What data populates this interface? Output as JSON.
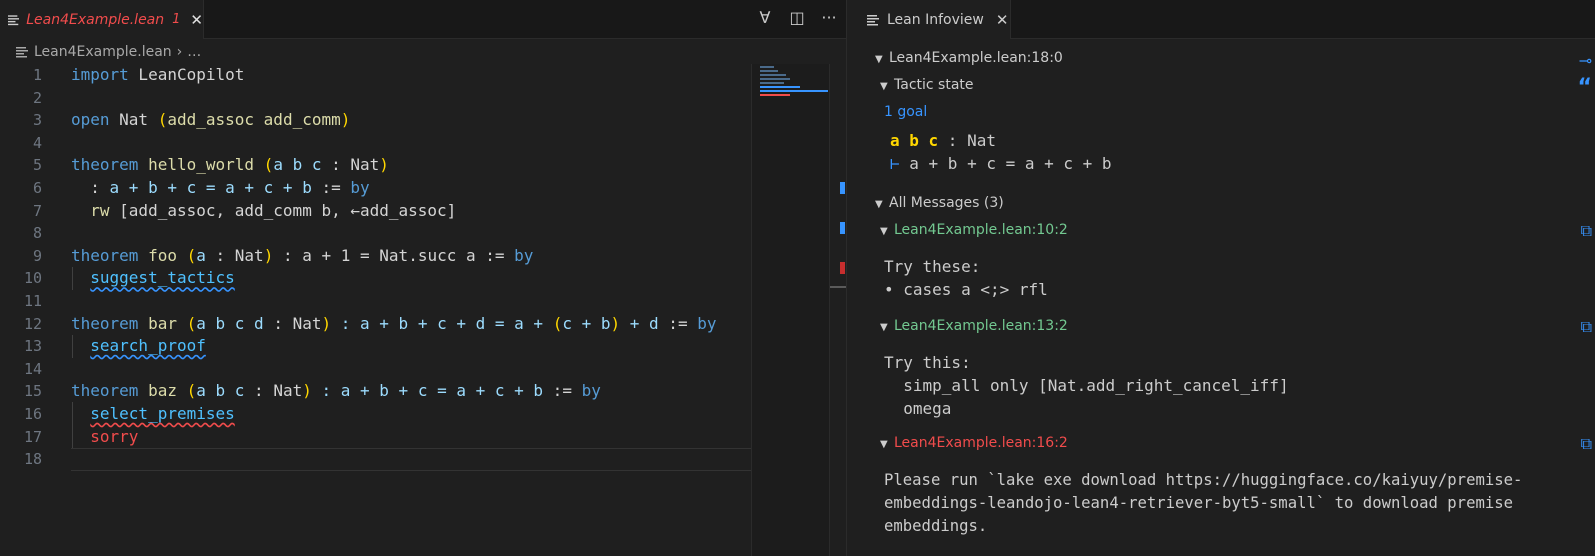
{
  "editor": {
    "tab": {
      "title": "Lean4Example.lean",
      "problem_count": "1"
    },
    "breadcrumb": {
      "file": "Lean4Example.lean",
      "more": "…"
    },
    "line_numbers": [
      "1",
      "2",
      "3",
      "4",
      "5",
      "6",
      "7",
      "8",
      "9",
      "10",
      "11",
      "12",
      "13",
      "14",
      "15",
      "16",
      "17",
      "18"
    ],
    "toolbar": {
      "lean_icon": "∀",
      "split": "◫",
      "more": "···"
    }
  },
  "code": {
    "l1": {
      "kw": "import",
      "rest": " LeanCopilot"
    },
    "l3": {
      "kw": "open",
      "rest": " Nat ",
      "lp": "(",
      "args": "add_assoc add_comm",
      "rp": ")"
    },
    "l5": {
      "kw": "theorem",
      "name": " hello_world ",
      "lp": "(",
      "vars": "a b c",
      "colon": " : Nat",
      "rp": ")"
    },
    "l6": {
      "pre": "  : ",
      "expr": "a + b + c = a + c + b",
      "assign": " := ",
      "by": "by"
    },
    "l7": {
      "pre": "  ",
      "tac": "rw",
      "rest": " [add_assoc, add_comm b, ←add_assoc]"
    },
    "l9": {
      "kw": "theorem",
      "name": " foo ",
      "lp": "(",
      "vars": "a",
      "colon": " : Nat",
      "rp": ")",
      "stmt": " : a + 1 = Nat.succ a",
      "assign": " := ",
      "by": "by"
    },
    "l10": {
      "pre": "  ",
      "tac": "suggest_tactics"
    },
    "l12": {
      "kw": "theorem",
      "name": " bar ",
      "lp": "(",
      "vars": "a b c d",
      "colon": " : Nat",
      "rp": ")",
      "s1": " : a + b + c + d = a + ",
      "lp2": "(",
      "inner": "c + b",
      "rp2": ")",
      "s2": " + d",
      "assign": " := ",
      "by": "by"
    },
    "l13": {
      "pre": "  ",
      "tac": "search_proof"
    },
    "l15": {
      "kw": "theorem",
      "name": " baz ",
      "lp": "(",
      "vars": "a b c",
      "colon": " : Nat",
      "rp": ")",
      "stmt": " : a + b + c = a + c + b",
      "assign": " := ",
      "by": "by"
    },
    "l16": {
      "pre": "  ",
      "tac": "select_premises"
    },
    "l17": {
      "pre": "  ",
      "tac": "sorry"
    }
  },
  "infoview": {
    "tab": {
      "title": "Lean Infoview"
    },
    "position": "Lean4Example.lean:18:0",
    "tactic_state_label": "Tactic state",
    "goal_count": "1 goal",
    "hyp": {
      "vars": "a b c",
      "type": " : Nat"
    },
    "goal": {
      "turnstile": "⊢",
      "expr": " a + b + c = a + c + b"
    },
    "all_messages": "All Messages (3)",
    "messages": [
      {
        "loc": "Lean4Example.lean:10:2",
        "line1": "Try these:",
        "line2": "• cases a <;> rfl"
      },
      {
        "loc": "Lean4Example.lean:13:2",
        "line1": "Try this:",
        "line2": "  simp_all only [Nat.add_right_cancel_iff]",
        "line3": "  omega"
      },
      {
        "loc": "Lean4Example.lean:16:2",
        "line1": "Please run `lake exe download https://huggingface.co/kaiyuy/premise-",
        "line2": "embeddings-leandojo-lean4-retriever-byt5-small` to download premise",
        "line3": "embeddings."
      }
    ]
  }
}
